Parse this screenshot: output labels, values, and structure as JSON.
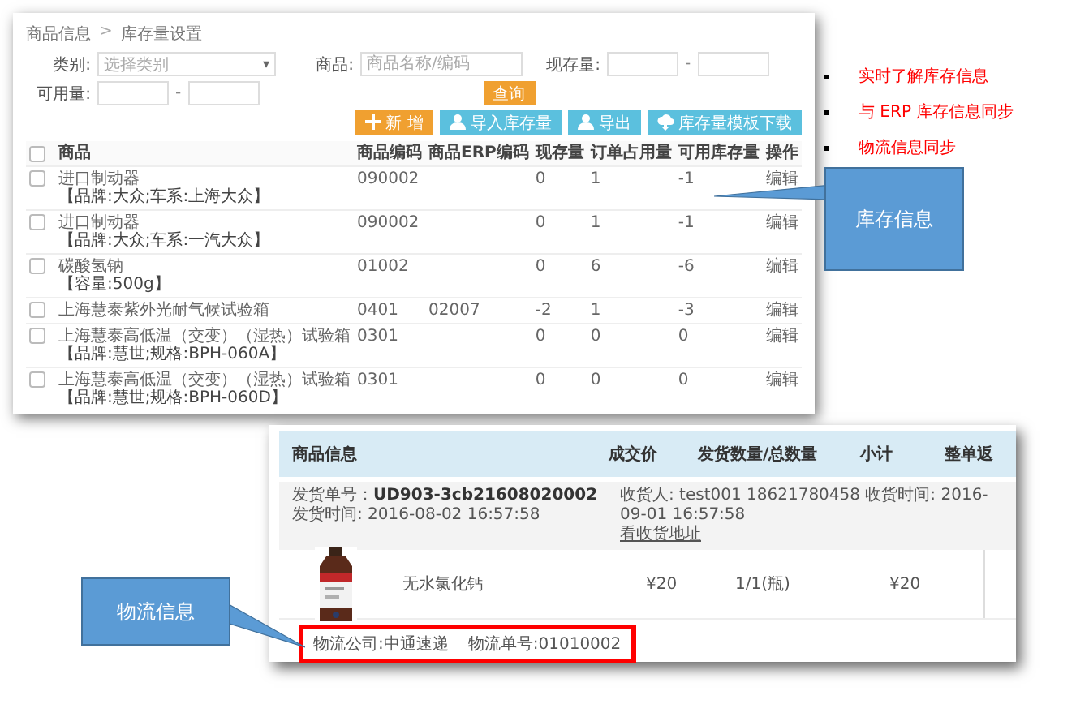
{
  "inventory_screen": {
    "breadcrumb": [
      {
        "label": "商品信息"
      },
      {
        "label": "库存量设置"
      }
    ],
    "breadcrumb_separator": ">",
    "filters": [
      {
        "kind": "select",
        "label": "类别:",
        "placeholder": "选择类别",
        "caret": "▾"
      },
      {
        "kind": "text",
        "label": "商品:",
        "placeholder": "商品名称/编码"
      },
      {
        "kind": "range",
        "label": "现存量:",
        "separator": "-"
      },
      {
        "kind": "range",
        "label": "可用量:",
        "separator": "-"
      }
    ],
    "query_button": "查询",
    "actions": [
      {
        "kind": "add",
        "label": "新 增"
      },
      {
        "kind": "import",
        "label": "导入库存量"
      },
      {
        "kind": "export",
        "label": "导出"
      },
      {
        "kind": "download",
        "label": "库存量模板下载"
      }
    ],
    "table": {
      "header_checked": false,
      "columns": [
        "商品",
        "商品编码",
        "商品ERP编码",
        "现存量",
        "订单占用量",
        "可用库存量",
        "操作"
      ],
      "rows": [
        {
          "checked": false,
          "name": "进口制动器",
          "spec": "【品牌:大众;车系:上海大众】",
          "code": "090002",
          "erp_code": "",
          "stock": "0",
          "reserved": "1",
          "available": "-1",
          "action": "编辑"
        },
        {
          "checked": false,
          "name": "进口制动器",
          "spec": "【品牌:大众;车系:一汽大众】",
          "code": "090002",
          "erp_code": "",
          "stock": "0",
          "reserved": "1",
          "available": "-1",
          "action": "编辑"
        },
        {
          "checked": false,
          "name": "碳酸氢钠",
          "spec": "【容量:500g】",
          "code": "01002",
          "erp_code": "",
          "stock": "0",
          "reserved": "6",
          "available": "-6",
          "action": "编辑"
        },
        {
          "checked": false,
          "name": "上海慧泰紫外光耐气候试验箱",
          "spec": "",
          "code": "0401",
          "erp_code": "02007",
          "stock": "-2",
          "reserved": "1",
          "available": "-3",
          "action": "编辑"
        },
        {
          "checked": false,
          "name": "上海慧泰高低温（交变）（湿热）试验箱",
          "spec": "【品牌:慧世;规格:BPH-060A】",
          "code": "0301",
          "erp_code": "",
          "stock": "0",
          "reserved": "0",
          "available": "0",
          "action": "编辑"
        },
        {
          "checked": false,
          "name": "上海慧泰高低温（交变）（湿热）试验箱",
          "spec": "【品牌:慧世;规格:BPH-060D】",
          "code": "0301",
          "erp_code": "",
          "stock": "0",
          "reserved": "0",
          "available": "0",
          "action": "编辑"
        }
      ]
    }
  },
  "bullets": [
    "实时了解库存信息",
    "与 ERP 库存信息同步",
    "物流信息同步"
  ],
  "callouts": [
    {
      "text": "库存信息"
    },
    {
      "text": "物流信息"
    }
  ],
  "order_screen": {
    "columns": [
      "商品信息",
      "成交价",
      "发货数量/总数量",
      "小计",
      "整单返"
    ],
    "shipment": "发货单号：**UD903-3cb21608020002**　发货时间: 2016-08-02 16:57:58",
    "receiver": "收货人: test001 18621780458 收货时间: 2016-09-01 16:57:58",
    "address_link": "看收货地址",
    "product": {
      "kind": "picture",
      "name": "无水氯化钙",
      "price": "¥20",
      "quantity": "1/1(瓶)",
      "subtotal": "¥20"
    },
    "logistics": {
      "company": "物流公司:中通速递",
      "number": "物流单号:01010002"
    }
  }
}
